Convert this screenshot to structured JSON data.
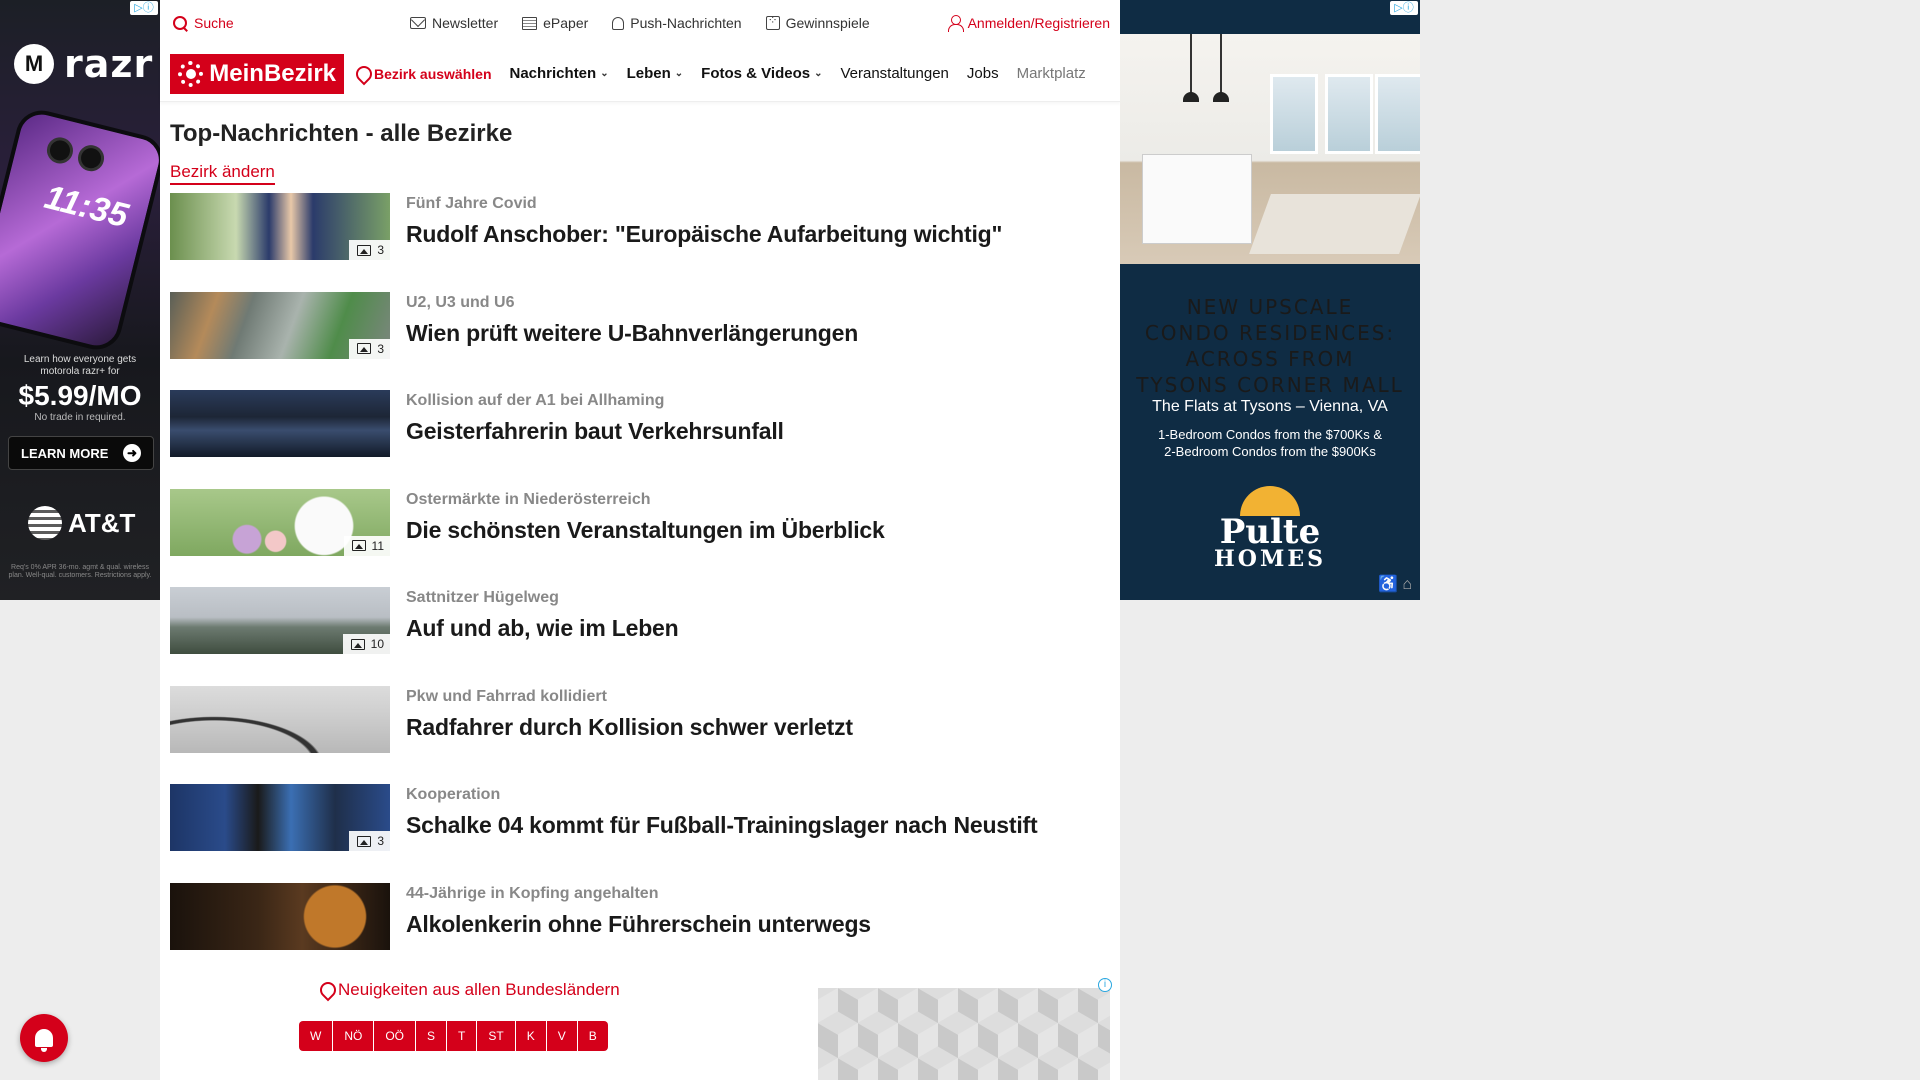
{
  "ad_left": {
    "brand": "razr",
    "brand_sup": "+",
    "phone_time": "11:35",
    "promo_line": "Learn how everyone gets motorola razr+ for",
    "price": "$5.99/MO",
    "promo_note": "No trade in required.",
    "cta": "LEARN MORE",
    "sponsor": "AT&T",
    "fine_print": "Req's 0% APR 36-mo. agmt & qual. wireless plan. Well-qual. customers. Restrictions apply."
  },
  "topbar": {
    "search": "Suche",
    "newsletter": "Newsletter",
    "epaper": "ePaper",
    "push": "Push-Nachrichten",
    "games": "Gewinnspiele",
    "login": "Anmelden/Registrieren"
  },
  "nav": {
    "logo": "MeinBezirk",
    "district": "Bezirk auswählen",
    "links": [
      "Nachrichten",
      "Leben",
      "Fotos & Videos",
      "Veranstaltungen",
      "Jobs",
      "Marktplatz"
    ]
  },
  "page": {
    "title": "Top-Nachrichten - alle Bezirke",
    "change_district": "Bezirk ändern"
  },
  "articles": [
    {
      "kicker": "Fünf Jahre Covid",
      "headline": "Rudolf Anschober: \"Europäische Aufarbeitung wichtig\"",
      "count": "3"
    },
    {
      "kicker": "U2, U3 und U6",
      "headline": "Wien prüft weitere U-Bahnverlängerungen",
      "count": "3"
    },
    {
      "kicker": "Kollision auf der A1 bei Allhaming",
      "headline": "Geisterfahrerin baut Verkehrsunfall",
      "count": ""
    },
    {
      "kicker": "Ostermärkte in Niederösterreich",
      "headline": "Die schönsten Veranstaltungen im Überblick",
      "count": "11"
    },
    {
      "kicker": "Sattnitzer Hügelweg",
      "headline": "Auf und ab, wie im Leben",
      "count": "10"
    },
    {
      "kicker": "Pkw und Fahrrad kollidiert",
      "headline": "Radfahrer durch Kollision schwer verletzt",
      "count": ""
    },
    {
      "kicker": "Kooperation",
      "headline": "Schalke 04 kommt für Fußball-Trainingslager nach Neustift",
      "count": "3"
    },
    {
      "kicker": "44-Jährige in Kopfing angehalten",
      "headline": "Alkolenkerin ohne Führerschein unterwegs",
      "count": ""
    }
  ],
  "bottom": {
    "all_news": "Neuigkeiten aus allen Bundesländern",
    "states": [
      "W",
      "NÖ",
      "OÖ",
      "S",
      "T",
      "ST",
      "K",
      "V",
      "B"
    ]
  },
  "ad_right": {
    "headline_lines": [
      "NEW UPSCALE",
      "CONDO RESIDENCES:",
      "ACROSS FROM",
      "TYSONS CORNER MALL"
    ],
    "subtitle": "The Flats at Tysons – Vienna, VA",
    "detail1": "1-Bedroom Condos from the $700Ks &",
    "detail2": "2-Bedroom Condos from the $900Ks",
    "brand1": "Pulte",
    "brand2": "HOMES"
  },
  "colors": {
    "brand_red": "#d4001a",
    "ad_right_bg": "#0f2c44"
  },
  "icons": {
    "search": "search-icon",
    "newsletter": "mail-icon",
    "epaper": "newspaper-icon",
    "push": "bell-icon",
    "games": "dice-icon",
    "login": "user-icon",
    "location": "location-pin-icon",
    "gallery": "image-gallery-icon"
  }
}
